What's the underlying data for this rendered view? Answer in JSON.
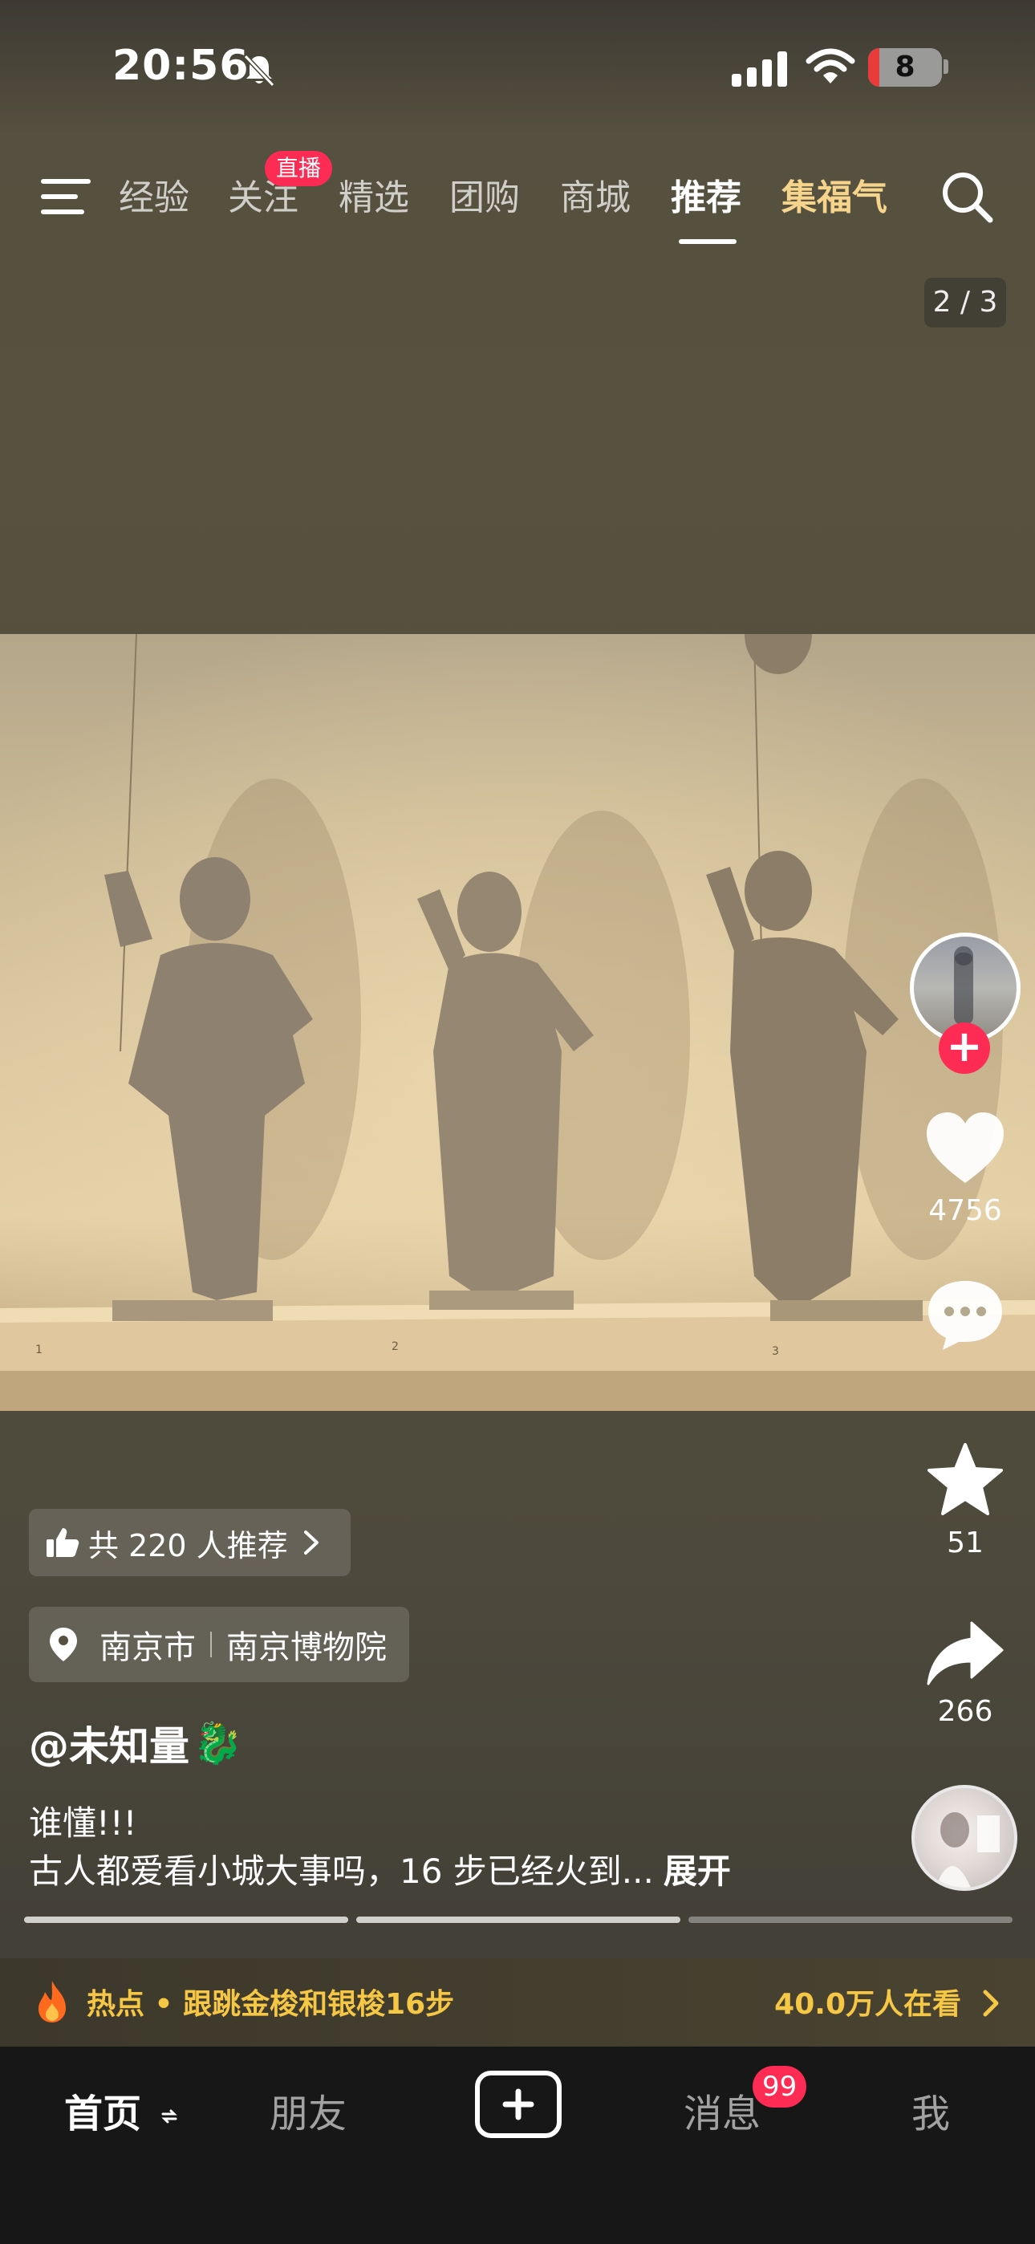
{
  "status_bar": {
    "time": "20:56",
    "battery": "8"
  },
  "top_nav": {
    "tabs": [
      {
        "label": "经验"
      },
      {
        "label": "关注",
        "badge": "直播"
      },
      {
        "label": "精选"
      },
      {
        "label": "团购"
      },
      {
        "label": "商城"
      },
      {
        "label": "推荐",
        "active": true
      },
      {
        "label": "集福气"
      }
    ]
  },
  "page_indicator": "2 / 3",
  "photo": {
    "exhibit_labels": [
      "1",
      "2",
      "3"
    ]
  },
  "sidebar": {
    "like_count": "4756",
    "favorite_count": "51",
    "share_count": "266"
  },
  "post": {
    "recommend": "共 220 人推荐",
    "location_city": "南京市",
    "location_place": "南京博物院",
    "author": "@未知量",
    "author_emoji": "🐉",
    "desc_line1": "谁懂!!!",
    "desc_line2": "古人都爱看小城大事吗，16 步已经火到...",
    "expand_label": "展开"
  },
  "hot_bar": {
    "text": "热点 • 跟跳金梭和银梭16步",
    "watching": "40.0万人在看"
  },
  "bottom_nav": {
    "home": "首页",
    "friends": "朋友",
    "messages": "消息",
    "messages_badge": "99",
    "me": "我"
  },
  "colors": {
    "accent": "#fe2c55",
    "hot": "#f5c744",
    "special_tab": "#f7d48b"
  }
}
